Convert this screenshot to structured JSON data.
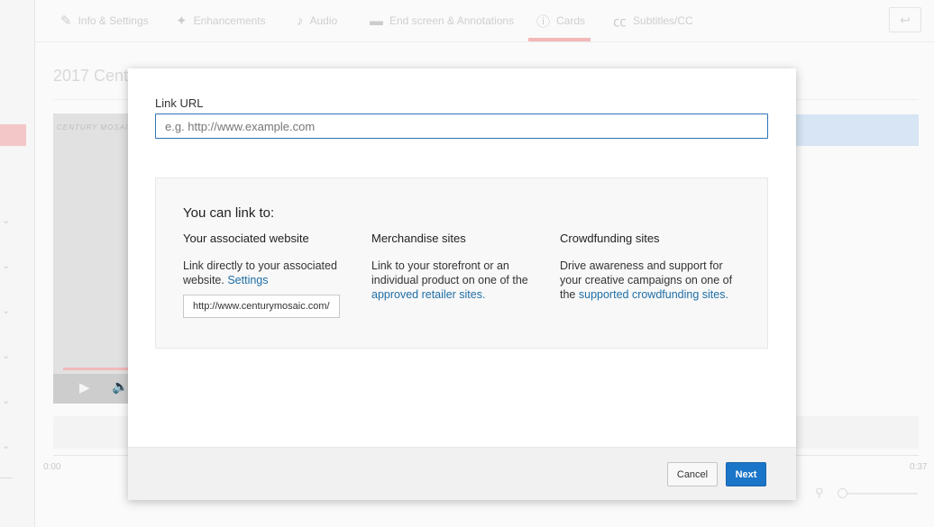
{
  "tabs": [
    {
      "label": "Info & Settings",
      "icon": "pencil-icon"
    },
    {
      "label": "Enhancements",
      "icon": "magic-wand-icon"
    },
    {
      "label": "Audio",
      "icon": "music-note-icon"
    },
    {
      "label": "End screen & Annotations",
      "icon": "end-screen-icon"
    },
    {
      "label": "Cards",
      "icon": "info-circle-icon",
      "active": true
    },
    {
      "label": "Subtitles/CC",
      "icon": "cc-icon"
    }
  ],
  "video": {
    "title": "2017 Cent",
    "logo_text": "CENTURY MOSAIC",
    "time_start": "0:00",
    "time_end": "0:37"
  },
  "modal": {
    "field_label": "Link URL",
    "url_value": "",
    "url_placeholder": "e.g. http://www.example.com",
    "info_heading": "You can link to:",
    "columns": [
      {
        "title": "Your associated website",
        "body": "Link directly to your associated website.",
        "link": "Settings",
        "site": "http://www.centurymosaic.com/"
      },
      {
        "title": "Merchandise sites",
        "body": "Link to your storefront or an individual product on one of the",
        "link": "approved retailer sites",
        "suffix": "."
      },
      {
        "title": "Crowdfunding sites",
        "body": "Drive awareness and support for your creative campaigns on one of the",
        "link": "supported crowdfunding sites",
        "suffix": "."
      }
    ],
    "cancel_label": "Cancel",
    "next_label": "Next"
  },
  "colors": {
    "accent": "#1b75c9",
    "link": "#1f6ea6",
    "active_tab_underline": "#f4b8b8"
  }
}
